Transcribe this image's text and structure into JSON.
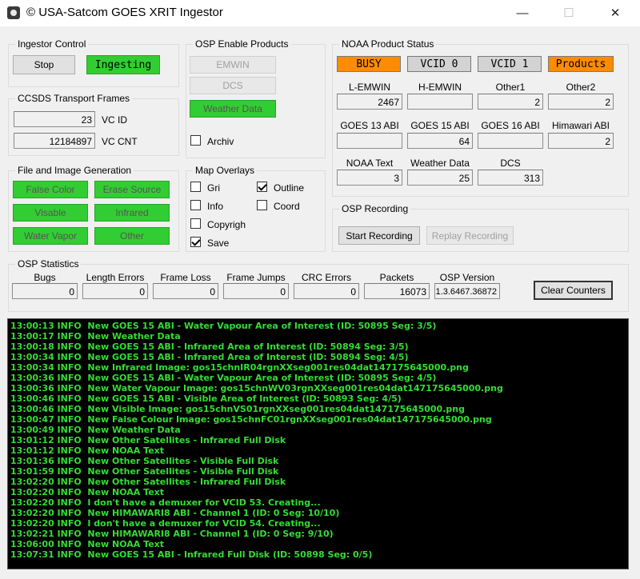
{
  "window": {
    "title": "© USA-Satcom GOES XRIT Ingestor",
    "minimize": "—",
    "maximize": "☐",
    "close": "✕"
  },
  "ingestor_control": {
    "label": "Ingestor Control",
    "stop_label": "Stop",
    "status_label": "Ingesting"
  },
  "ccsds": {
    "label": "CCSDS Transport Frames",
    "vcid_value": "23",
    "vcid_label": "VC ID",
    "vccnt_value": "12184897",
    "vccnt_label": "VC CNT"
  },
  "file_gen": {
    "label": "File and Image Generation",
    "buttons": [
      "False Color",
      "Erase Source",
      "Visable",
      "Infrared",
      "Water Vapor",
      "Other"
    ]
  },
  "osp_enable": {
    "label": "OSP Enable Products",
    "emwin": "EMWIN",
    "dcs": "DCS",
    "weather": "Weather Data",
    "archiv": "Archiv"
  },
  "map_overlays": {
    "label": "Map Overlays",
    "items": [
      {
        "label": "Gri",
        "checked": false
      },
      {
        "label": "Outline",
        "checked": true
      },
      {
        "label": "Info",
        "checked": false
      },
      {
        "label": "Coord",
        "checked": false
      },
      {
        "label": "Copyrigh",
        "checked": false
      },
      {
        "label": "Save",
        "checked": true
      }
    ]
  },
  "noaa_status": {
    "label": "NOAA Product Status",
    "indicators": [
      {
        "label": "BUSY",
        "color": "#ff8c00"
      },
      {
        "label": "VCID 0",
        "color": "#d3d3d3"
      },
      {
        "label": "VCID 1",
        "color": "#d3d3d3"
      },
      {
        "label": "Products",
        "color": "#ff8c00"
      }
    ],
    "rows": [
      [
        {
          "label": "L-EMWIN",
          "value": "2467"
        },
        {
          "label": "H-EMWIN",
          "value": ""
        },
        {
          "label": "Other1",
          "value": "2"
        },
        {
          "label": "Other2",
          "value": "2"
        }
      ],
      [
        {
          "label": "GOES 13 ABI",
          "value": ""
        },
        {
          "label": "GOES 15 ABI",
          "value": "64"
        },
        {
          "label": "GOES 16 ABI",
          "value": ""
        },
        {
          "label": "Himawari ABI",
          "value": "2"
        }
      ],
      [
        {
          "label": "NOAA Text",
          "value": "3"
        },
        {
          "label": "Weather Data",
          "value": "25"
        },
        {
          "label": "DCS",
          "value": "313"
        }
      ]
    ]
  },
  "osp_recording": {
    "label": "OSP Recording",
    "start": "Start Recording",
    "replay": "Replay Recording"
  },
  "osp_statistics": {
    "label": "OSP Statistics",
    "fields": [
      {
        "label": "Bugs",
        "value": "0"
      },
      {
        "label": "Length Errors",
        "value": "0"
      },
      {
        "label": "Frame Loss",
        "value": "0"
      },
      {
        "label": "Frame Jumps",
        "value": "0"
      },
      {
        "label": "CRC Errors",
        "value": "0"
      },
      {
        "label": "Packets",
        "value": "16073"
      },
      {
        "label": "OSP Version",
        "value": "1.3.6467.36872"
      }
    ],
    "clear": "Clear Counters"
  },
  "log": [
    "13:00:13 INFO  New GOES 15 ABI - Water Vapour Area of Interest (ID: 50895 Seg: 3/5)",
    "13:00:17 INFO  New Weather Data",
    "13:00:18 INFO  New GOES 15 ABI - Infrared Area of Interest (ID: 50894 Seg: 3/5)",
    "13:00:34 INFO  New GOES 15 ABI - Infrared Area of Interest (ID: 50894 Seg: 4/5)",
    "13:00:34 INFO  New Infrared Image: gos15chnIR04rgnXXseg001res04dat147175645000.png",
    "13:00:36 INFO  New GOES 15 ABI - Water Vapour Area of Interest (ID: 50895 Seg: 4/5)",
    "13:00:36 INFO  New Water Vapour Image: gos15chnWV03rgnXXseg001res04dat147175645000.png",
    "13:00:46 INFO  New GOES 15 ABI - Visible Area of Interest (ID: 50893 Seg: 4/5)",
    "13:00:46 INFO  New Visible Image: gos15chnVS01rgnXXseg001res04dat147175645000.png",
    "13:00:47 INFO  New False Colour Image: gos15chnFC01rgnXXseg001res04dat147175645000.png",
    "13:00:49 INFO  New Weather Data",
    "13:01:12 INFO  New Other Satellites - Infrared Full Disk",
    "13:01:12 INFO  New NOAA Text",
    "13:01:36 INFO  New Other Satellites - Visible Full Disk",
    "13:01:59 INFO  New Other Satellites - Visible Full Disk",
    "13:02:20 INFO  New Other Satellites - Infrared Full Disk",
    "13:02:20 INFO  New NOAA Text",
    "13:02:20 INFO  I don't have a demuxer for VCID 53. Creating...",
    "13:02:20 INFO  New HIMAWARI8 ABI - Channel 1 (ID: 0 Seg: 10/10)",
    "13:02:20 INFO  I don't have a demuxer for VCID 54. Creating...",
    "13:02:21 INFO  New HIMAWARI8 ABI - Channel 1 (ID: 0 Seg: 9/10)",
    "13:06:00 INFO  New NOAA Text",
    "13:07:31 INFO  New GOES 15 ABI - Infrared Full Disk (ID: 50898 Seg: 0/5)"
  ]
}
